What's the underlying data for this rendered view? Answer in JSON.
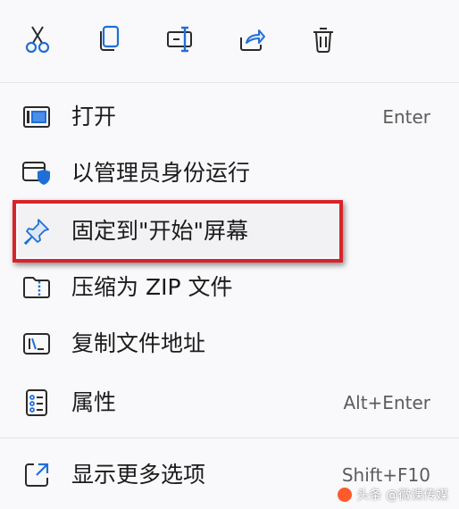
{
  "toolbar": {
    "buttons": [
      {
        "icon": "scissors-icon"
      },
      {
        "icon": "copy-icon"
      },
      {
        "icon": "rename-icon"
      },
      {
        "icon": "share-icon"
      },
      {
        "icon": "trash-icon"
      }
    ]
  },
  "menu": {
    "items": [
      {
        "label": "打开",
        "shortcut": "Enter",
        "icon": "open-app-icon"
      },
      {
        "label": "以管理员身份运行",
        "shortcut": "",
        "icon": "admin-shield-icon"
      },
      {
        "label": "固定到\"开始\"屏幕",
        "shortcut": "",
        "icon": "pin-icon"
      },
      {
        "label": "压缩为 ZIP 文件",
        "shortcut": "",
        "icon": "zip-folder-icon"
      },
      {
        "label": "复制文件地址",
        "shortcut": "",
        "icon": "copy-path-icon"
      },
      {
        "label": "属性",
        "shortcut": "Alt+Enter",
        "icon": "properties-icon"
      }
    ],
    "more": {
      "label": "显示更多选项",
      "shortcut": "Shift+F10",
      "icon": "open-external-icon"
    }
  },
  "watermark": {
    "text": "头条 @微课传媒"
  },
  "colors": {
    "accent": "#1f6fd8",
    "highlight_border": "#d8232a"
  }
}
